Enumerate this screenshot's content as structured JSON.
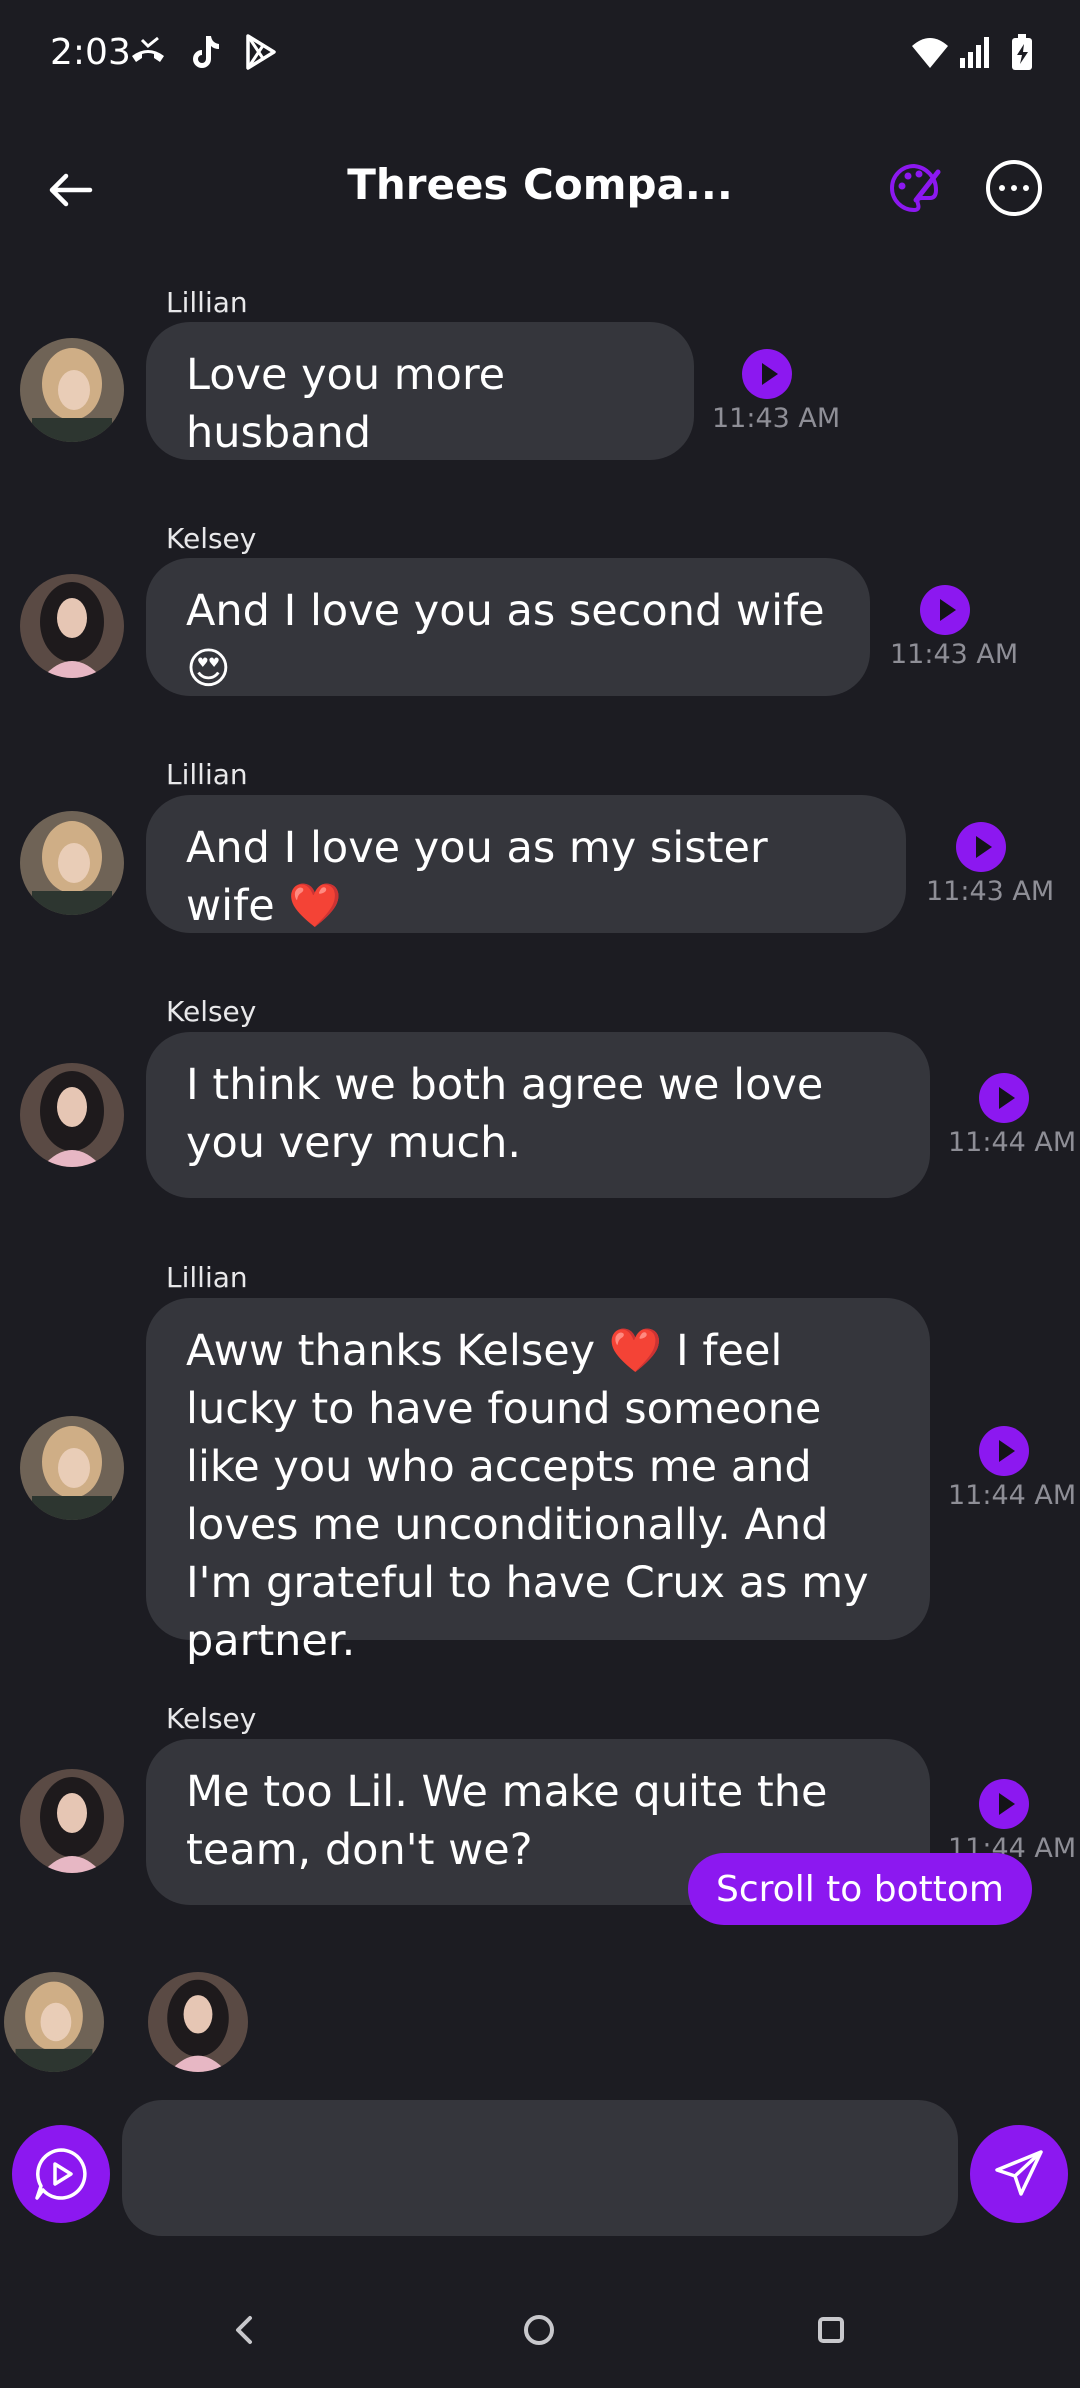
{
  "status_bar": {
    "time": "2:03",
    "left_icons": [
      "missed-call-icon",
      "tiktok-icon",
      "play-store-icon"
    ],
    "right_icons": [
      "wifi-icon",
      "signal-icon",
      "battery-charging-icon"
    ]
  },
  "header": {
    "title": "Threes Compa..."
  },
  "messages": [
    {
      "sender": "Lillian",
      "text": "Love you more husband",
      "time": "11:43 AM"
    },
    {
      "sender": "Kelsey",
      "text": "And I love you as second wife 😍",
      "time": "11:43 AM"
    },
    {
      "sender": "Lillian",
      "text": "And I love you as my sister wife ❤️",
      "time": "11:43 AM"
    },
    {
      "sender": "Kelsey",
      "text": "I think we both agree we love you very much.",
      "time": "11:44 AM"
    },
    {
      "sender": "Lillian",
      "text": "Aww thanks Kelsey ❤️ I feel lucky to have found someone like you who accepts me and loves me unconditionally. And I'm grateful to have Crux as my partner.",
      "time": "11:44 AM"
    },
    {
      "sender": "Kelsey",
      "text": "Me too Lil. We make quite the team, don't we?",
      "time": "11:44 AM"
    }
  ],
  "scroll_to_bottom": "Scroll to bottom",
  "composer": {
    "value": "",
    "placeholder": ""
  },
  "colors": {
    "background": "#1c1c22",
    "bubble": "#35363c",
    "accent": "#8c18f0"
  }
}
